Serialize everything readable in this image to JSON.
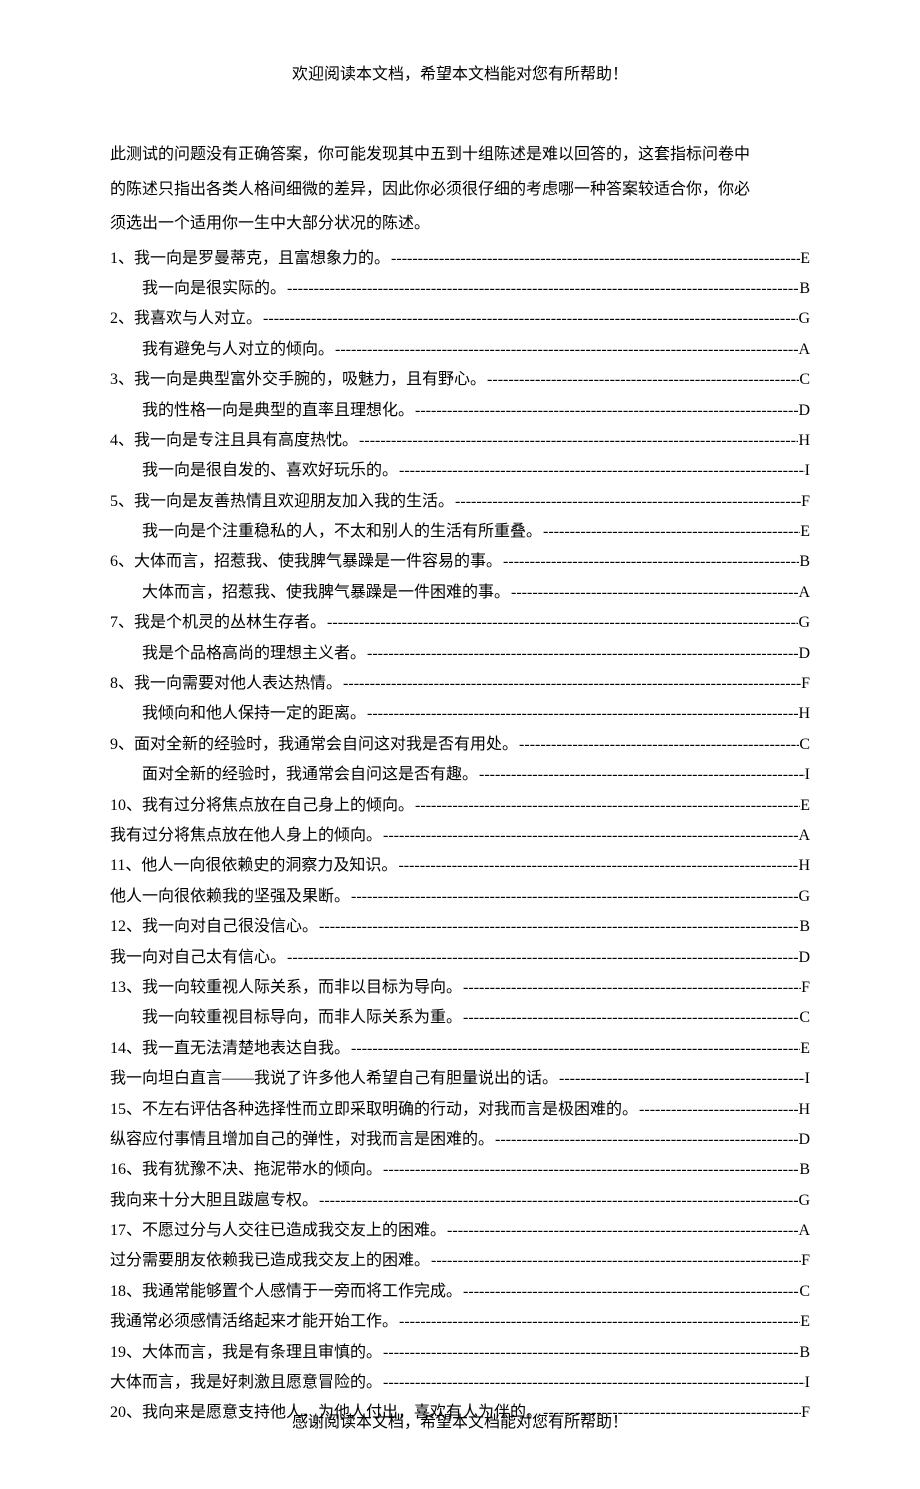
{
  "header": "欢迎阅读本文档，希望本文档能对您有所帮助！",
  "footer": "感谢阅读本文档，希望本文档能对您有所帮助！",
  "intro": [
    "此测试的问题没有正确答案，你可能发现其中五到十组陈述是难以回答的，这套指标问卷中",
    "的陈述只指出各类人格间细微的差异，因此你必须很仔细的考虑哪一种答案较适合你，你必",
    "须选出一个适用你一生中大部分状况的陈述。"
  ],
  "items": [
    {
      "num": "1、",
      "a_text": "我一向是罗曼蒂克，且富想象力的。",
      "a_ans": "E",
      "a_indent": false,
      "b_text": "我一向是很实际的。",
      "b_ans": "B",
      "b_indent": true
    },
    {
      "num": "2、",
      "a_text": "我喜欢与人对立。",
      "a_ans": "G",
      "a_indent": false,
      "b_text": "我有避免与人对立的倾向。",
      "b_ans": "A",
      "b_indent": true
    },
    {
      "num": "3、",
      "a_text": "我一向是典型富外交手腕的，吸魅力，且有野心。",
      "a_ans": "C",
      "a_indent": false,
      "b_text": "我的性格一向是典型的直率且理想化。",
      "b_ans": "D",
      "b_indent": true
    },
    {
      "num": "4、",
      "a_text": "我一向是专注且具有高度热忱。",
      "a_ans": "H",
      "a_indent": false,
      "b_text": "我一向是很自发的、喜欢好玩乐的。",
      "b_ans": "I",
      "b_indent": true
    },
    {
      "num": "5、",
      "a_text": "我一向是友善热情且欢迎朋友加入我的生活。",
      "a_ans": "F",
      "a_indent": false,
      "b_text": "我一向是个注重稳私的人，不太和别人的生活有所重叠。",
      "b_ans": "E",
      "b_indent": true
    },
    {
      "num": "6、",
      "a_text": "大体而言，招惹我、使我脾气暴躁是一件容易的事。",
      "a_ans": "B",
      "a_indent": false,
      "b_text": "大体而言，招惹我、使我脾气暴躁是一件困难的事。",
      "b_ans": "A",
      "b_indent": true
    },
    {
      "num": "7、",
      "a_text": "我是个机灵的丛林生存者。",
      "a_ans": "G",
      "a_indent": false,
      "b_text": "我是个品格高尚的理想主义者。",
      "b_ans": "D",
      "b_indent": true
    },
    {
      "num": "8、",
      "a_text": "我一向需要对他人表达热情。",
      "a_ans": "F",
      "a_indent": false,
      "b_text": "我倾向和他人保持一定的距离。",
      "b_ans": "H",
      "b_indent": true
    },
    {
      "num": "9、",
      "a_text": "面对全新的经验时，我通常会自问这对我是否有用处。",
      "a_ans": "C",
      "a_indent": false,
      "b_text": "面对全新的经验时，我通常会自问这是否有趣。",
      "b_ans": "I",
      "b_indent": true
    },
    {
      "num": "10、",
      "a_text": "我有过分将焦点放在自己身上的倾向。",
      "a_ans": "E",
      "a_indent": false,
      "b_text": "我有过分将焦点放在他人身上的倾向。",
      "b_ans": "A",
      "b_indent": false
    },
    {
      "num": "11、",
      "a_text": "他人一向很依赖史的洞察力及知识。",
      "a_ans": "H",
      "a_indent": false,
      "b_text": "他人一向很依赖我的坚强及果断。",
      "b_ans": "G",
      "b_indent": false
    },
    {
      "num": "12、",
      "a_text": "我一向对自己很没信心。",
      "a_ans": "B",
      "a_indent": false,
      "b_text": "我一向对自己太有信心。",
      "b_ans": "D",
      "b_indent": false
    },
    {
      "num": "13、",
      "a_text": "我一向较重视人际关系，而非以目标为导向。",
      "a_ans": "F",
      "a_indent": false,
      "b_text": "我一向较重视目标导向，而非人际关系为重。",
      "b_ans": "C",
      "b_indent": true
    },
    {
      "num": "14、",
      "a_text": "我一直无法清楚地表达自我。",
      "a_ans": "E",
      "a_indent": false,
      "b_text": "我一向坦白直言——我说了许多他人希望自己有胆量说出的话。",
      "b_ans": "I",
      "b_indent": false
    },
    {
      "num": "15、",
      "a_text": "不左右评估各种选择性而立即采取明确的行动，对我而言是极困难的。",
      "a_ans": "H",
      "a_indent": false,
      "b_text": "纵容应付事情且增加自己的弹性，对我而言是困难的。",
      "b_ans": "D",
      "b_indent": false
    },
    {
      "num": "16、",
      "a_text": "我有犹豫不决、拖泥带水的倾向。",
      "a_ans": "B",
      "a_indent": false,
      "b_text": "我向来十分大胆且跋扈专权。",
      "b_ans": "G",
      "b_indent": false
    },
    {
      "num": "17、",
      "a_text": "不愿过分与人交往已造成我交友上的困难。",
      "a_ans": "A",
      "a_indent": false,
      "b_text": "过分需要朋友依赖我已造成我交友上的困难。",
      "b_ans": "F",
      "b_indent": false
    },
    {
      "num": "18、",
      "a_text": "我通常能够置个人感情于一旁而将工作完成。",
      "a_ans": "C",
      "a_indent": false,
      "b_text": "我通常必须感情活络起来才能开始工作。",
      "b_ans": "E",
      "b_indent": false
    },
    {
      "num": "19、",
      "a_text": "大体而言，我是有条理且审慎的。",
      "a_ans": "B",
      "a_indent": false,
      "b_text": "大体而言，我是好刺激且愿意冒险的。",
      "b_ans": "I",
      "b_indent": false
    },
    {
      "num": "20、",
      "a_text": "我向来是愿意支持他人，为他人付出，喜欢有人为伴的。",
      "a_ans": "F",
      "a_indent": false,
      "b_text": "",
      "b_ans": "",
      "b_indent": false
    }
  ]
}
